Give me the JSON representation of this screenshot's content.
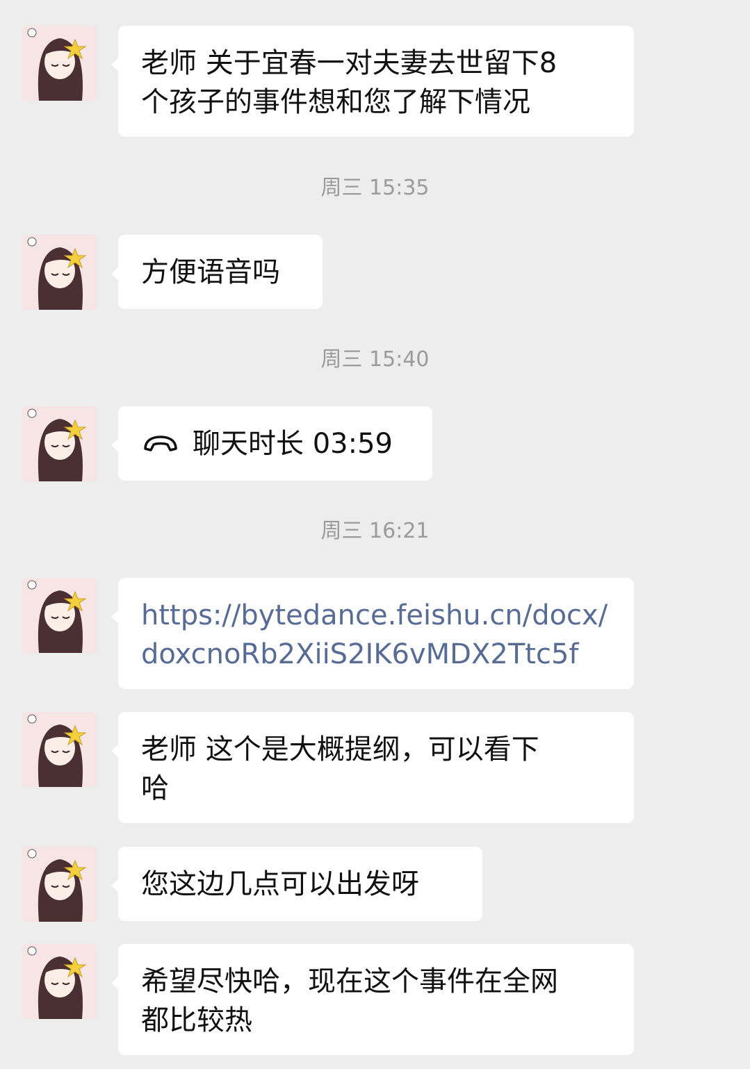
{
  "conversation": {
    "messages": [
      {
        "sender": "contact",
        "avatar_icon": "anime-girl-avatar-icon",
        "text": "老师 关于宜春一对夫妻去世留下8\n个孩子的事件想和您了解下情况"
      },
      {
        "sender": "contact",
        "avatar_icon": "anime-girl-avatar-icon",
        "text": "方便语音吗"
      },
      {
        "sender": "contact",
        "avatar_icon": "anime-girl-avatar-icon",
        "type": "voice_call",
        "icon": "phone-hangup-icon",
        "text": "聊天时长 03:59"
      },
      {
        "sender": "contact",
        "avatar_icon": "anime-girl-avatar-icon",
        "type": "link",
        "text": "https://bytedance.feishu.cn/docx/\ndoxcnoRb2XiiS2IK6vMDX2Ttc5f"
      },
      {
        "sender": "contact",
        "avatar_icon": "anime-girl-avatar-icon",
        "text": "老师 这个是大概提纲，可以看下\n哈"
      },
      {
        "sender": "contact",
        "avatar_icon": "anime-girl-avatar-icon",
        "text": "您这边几点可以出发呀"
      },
      {
        "sender": "contact",
        "avatar_icon": "anime-girl-avatar-icon",
        "text": "希望尽快哈，现在这个事件在全网\n都比较热"
      }
    ],
    "timestamps": [
      "周三 15:35",
      "周三 15:40",
      "周三 16:21"
    ]
  },
  "colors": {
    "background": "#ededed",
    "bubble": "#ffffff",
    "link": "#576b95",
    "timestamp": "#9b9b9b"
  }
}
